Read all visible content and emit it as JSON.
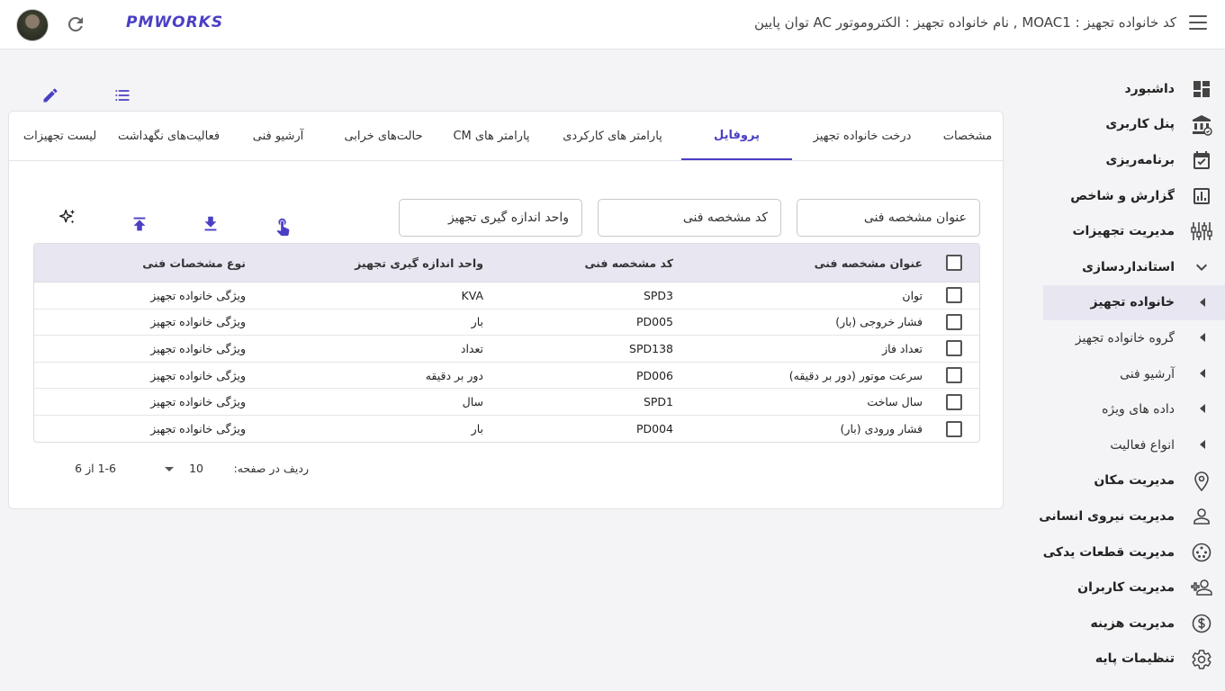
{
  "header": {
    "breadcrumb": "کد خانواده تجهیز : MOAC1 , نام خانواده تجهیز : الکتروموتور AC توان پایین",
    "logo": "PMWORKS"
  },
  "sidebar": {
    "items": [
      {
        "label": "داشبورد",
        "icon": "dashboard-icon",
        "bold": true
      },
      {
        "label": "پنل کاربری",
        "icon": "bank-icon",
        "bold": true
      },
      {
        "label": "برنامه‌ریزی",
        "icon": "calendar-check-icon",
        "bold": true
      },
      {
        "label": "گزارش و شاخص",
        "icon": "bar-chart-icon",
        "bold": true
      },
      {
        "label": "مدیریت تجهیزات",
        "icon": "equipment-icon",
        "bold": true
      },
      {
        "label": "استانداردسازی",
        "icon": "chevron-down-icon",
        "bold": true
      },
      {
        "label": "خانواده تجهیز",
        "icon": "caret-left-icon",
        "bold": true,
        "active": true
      },
      {
        "label": "گروه خانواده تجهیز",
        "icon": "caret-left-icon",
        "bold": false
      },
      {
        "label": "آرشیو فنی",
        "icon": "caret-left-icon",
        "bold": false
      },
      {
        "label": "داده های ویژه",
        "icon": "caret-left-icon",
        "bold": false
      },
      {
        "label": "انواع فعالیت",
        "icon": "caret-left-icon",
        "bold": false
      },
      {
        "label": "مدیریت مکان",
        "icon": "location-icon",
        "bold": true
      },
      {
        "label": "مدیریت نیروی انسانی",
        "icon": "person-icon",
        "bold": true
      },
      {
        "label": "مدیریت قطعات یدکی",
        "icon": "spare-parts-icon",
        "bold": true
      },
      {
        "label": "مدیریت کاربران",
        "icon": "add-user-icon",
        "bold": true
      },
      {
        "label": "مدیریت هزینه",
        "icon": "dollar-icon",
        "bold": true
      },
      {
        "label": "تنظیمات پایه",
        "icon": "gear-icon",
        "bold": true
      }
    ]
  },
  "tabs": [
    {
      "label": "مشخصات",
      "active": false
    },
    {
      "label": "درخت خانواده تجهیز",
      "active": false
    },
    {
      "label": "پروفایل",
      "active": true
    },
    {
      "label": "پارامتر های کارکردی",
      "active": false
    },
    {
      "label": "پارامتر های CM",
      "active": false
    },
    {
      "label": "حالت‌های خرابی",
      "active": false
    },
    {
      "label": "آرشیو فنی",
      "active": false
    },
    {
      "label": "فعالیت‌های نگهداشت",
      "active": false
    },
    {
      "label": "لیست تجهیزات",
      "active": false
    }
  ],
  "filters": {
    "title": "عنوان مشخصه فنی",
    "code": "کد مشخصه فنی",
    "unit": "واحد اندازه گیری تجهیز"
  },
  "table": {
    "headers": {
      "title": "عنوان مشخصه فنی",
      "code": "کد مشخصه فنی",
      "unit": "واحد اندازه گیری تجهیز",
      "type": "نوع مشخصات فنی"
    },
    "rows": [
      {
        "title": "توان",
        "code": "SPD3",
        "unit": "KVA",
        "type": "ویژگی خانواده تجهیز"
      },
      {
        "title": "فشار خروجی (بار)",
        "code": "PD005",
        "unit": "بار",
        "type": "ویژگی خانواده تجهیز"
      },
      {
        "title": "تعداد فاز",
        "code": "SPD138",
        "unit": "تعداد",
        "type": "ویژگی خانواده تجهیز"
      },
      {
        "title": "سرعت موتور (دور بر دقیقه)",
        "code": "PD006",
        "unit": "دور بر دقیقه",
        "type": "ویژگی خانواده تجهیز"
      },
      {
        "title": "سال ساخت",
        "code": "SPD1",
        "unit": "سال",
        "type": "ویژگی خانواده تجهیز"
      },
      {
        "title": "فشار ورودی (بار)",
        "code": "PD004",
        "unit": "بار",
        "type": "ویژگی خانواده تجهیز"
      }
    ]
  },
  "pager": {
    "rows_per_page_label": "ردیف در صفحه:",
    "rows_per_page": "10",
    "range": "1-6 از 6"
  },
  "colors": {
    "accent": "#4a3fc4",
    "header_bg": "#e8e6f1"
  }
}
